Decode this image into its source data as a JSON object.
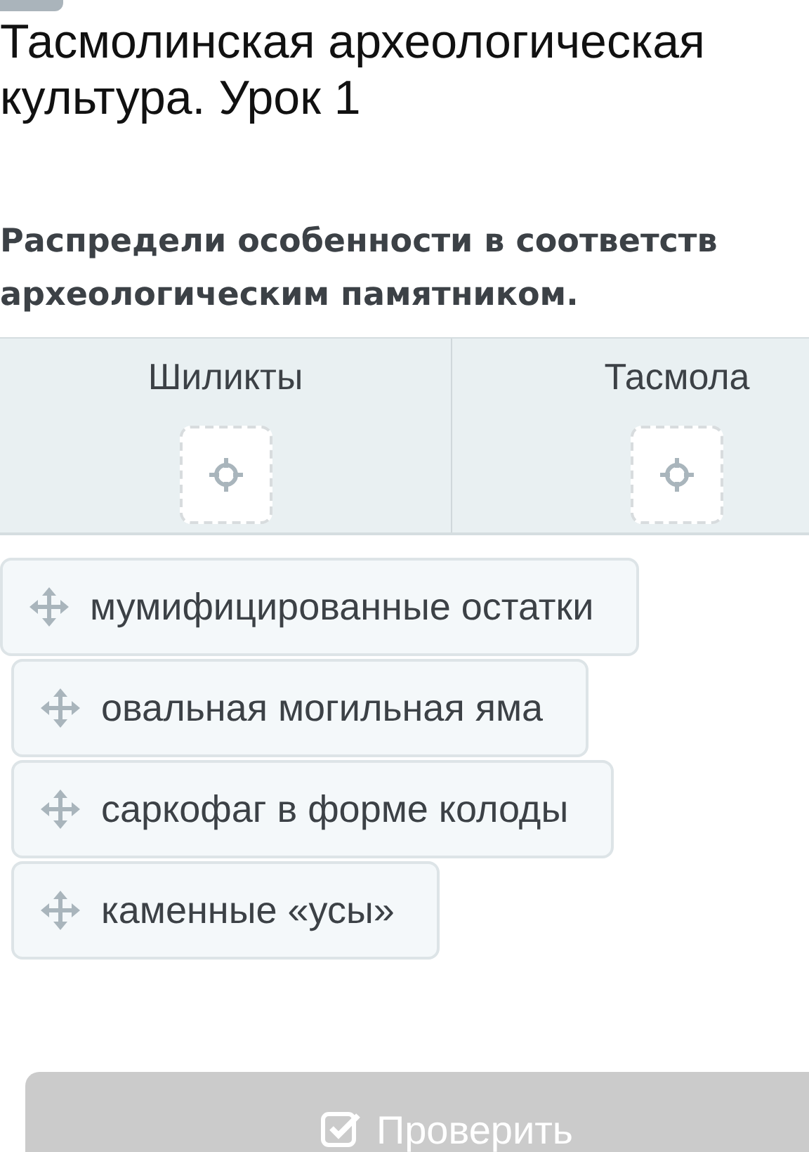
{
  "title": "Тасмолинская археологическая культура. Урок 1",
  "instruction_lines": [
    "Распредели особенности в соответств",
    "археологическим памятником."
  ],
  "columns": [
    {
      "heading": "Шиликты"
    },
    {
      "heading": "Тасмола"
    }
  ],
  "items": [
    "мумифицированные остатки",
    "овальная могильная яма",
    "саркофаг в форме колоды",
    "каменные «усы»"
  ],
  "check_button": {
    "label": "Проверить",
    "disabled": true
  }
}
